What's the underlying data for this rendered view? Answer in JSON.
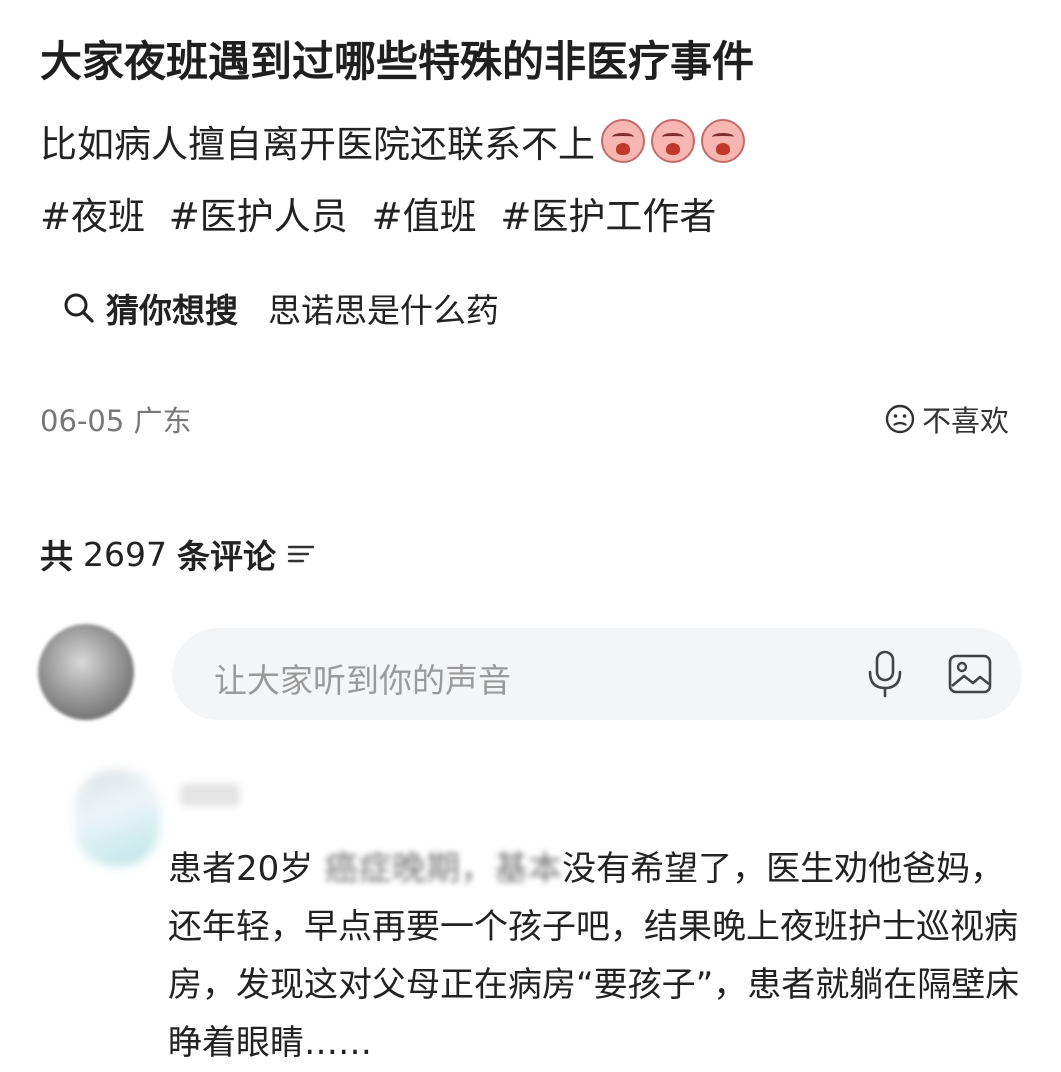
{
  "post": {
    "title": "大家夜班遇到过哪些特殊的非医疗事件",
    "body_text": "比如病人擅自离开医院还联系不上",
    "emoji_name": "crying-face-icon",
    "tags": [
      "#夜班",
      "#医护人员",
      "#值班",
      "#医护工作者"
    ]
  },
  "guess_search": {
    "label": "猜你想搜",
    "query": "思诺思是什么药"
  },
  "meta": {
    "date_location": "06-05 广东",
    "dislike_label": "不喜欢"
  },
  "comments_header": {
    "prefix": "共",
    "count": "2697",
    "suffix": "条评论"
  },
  "comment_input": {
    "placeholder": "让大家听到你的声音"
  },
  "comment": {
    "text_before": "患者20岁 ",
    "text_blurred": "癌症晚期，基本",
    "text_after": "没有希望了，医生劝他爸妈，还年轻，早点再要一个孩子吧，结果晚上夜班护士巡视病房，发现这对父母正在病房“要孩子”，患者就躺在隔壁床睁着眼睛……"
  },
  "colors": {
    "input_bg": "#f4f5f7",
    "placeholder": "#9a9a9a",
    "meta_text": "#777777"
  }
}
